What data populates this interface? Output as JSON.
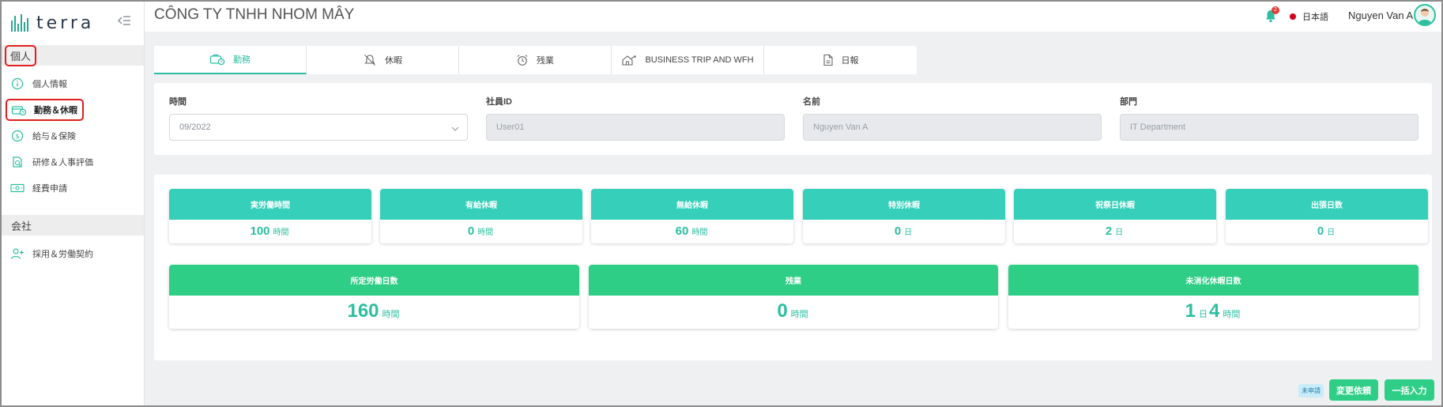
{
  "app": {
    "logo_text": "terra",
    "company_name": "CÔNG TY TNHH NHOM MÂY",
    "notification_count": "2",
    "language": "日本語",
    "user_name": "Nguyen Van A",
    "colors": {
      "accent": "#2bbfa0",
      "teal": "#36cfb9",
      "green": "#2fce86",
      "highlight": "#e02020"
    }
  },
  "sidebar": {
    "sections": [
      {
        "title": "個人",
        "items": [
          {
            "label": "個人情報",
            "icon": "info-circle-icon"
          },
          {
            "label": "勤務＆休暇",
            "icon": "clock-calendar-icon",
            "active": true
          },
          {
            "label": "給与＆保険",
            "icon": "dollar-circle-icon"
          },
          {
            "label": "研修＆人事評価",
            "icon": "document-review-icon"
          },
          {
            "label": "経費申請",
            "icon": "money-bill-icon"
          }
        ]
      },
      {
        "title": "会社",
        "items": [
          {
            "label": "採用＆労働契約",
            "icon": "user-add-icon"
          }
        ]
      }
    ]
  },
  "tabs": [
    {
      "label": "勤務",
      "icon": "briefcase-clock-icon",
      "active": true
    },
    {
      "label": "休暇",
      "icon": "bell-off-icon"
    },
    {
      "label": "残業",
      "icon": "alarm-clock-icon"
    },
    {
      "label": "BUSINESS TRIP AND WFH",
      "icon": "trip-icon"
    },
    {
      "label": "日報",
      "icon": "file-icon"
    }
  ],
  "filters": {
    "period": {
      "label": "時間",
      "value": "09/2022"
    },
    "employee_id": {
      "label": "社員ID",
      "value": "User01"
    },
    "name": {
      "label": "名前",
      "value": "Nguyen Van A"
    },
    "department": {
      "label": "部門",
      "value": "IT Department"
    }
  },
  "stats_row1": [
    {
      "title": "実労働時間",
      "value": "100",
      "unit": "時間"
    },
    {
      "title": "有給休暇",
      "value": "0",
      "unit": "時間"
    },
    {
      "title": "無給休暇",
      "value": "60",
      "unit": "時間"
    },
    {
      "title": "特別休暇",
      "value": "0",
      "unit": "日"
    },
    {
      "title": "祝祭日休暇",
      "value": "2",
      "unit": "日"
    },
    {
      "title": "出張日数",
      "value": "0",
      "unit": "日"
    }
  ],
  "stats_row2": [
    {
      "title": "所定労働日数",
      "value": "160",
      "unit": "時間"
    },
    {
      "title": "残業",
      "value": "0",
      "unit": "時間"
    },
    {
      "title": "未消化休暇日数",
      "value": "1",
      "unit": "日",
      "value2": "4",
      "unit2": "時間"
    }
  ],
  "footer": {
    "status_tag": "未申請",
    "change_request_label": "変更依頼",
    "bulk_input_label": "一括入力"
  }
}
